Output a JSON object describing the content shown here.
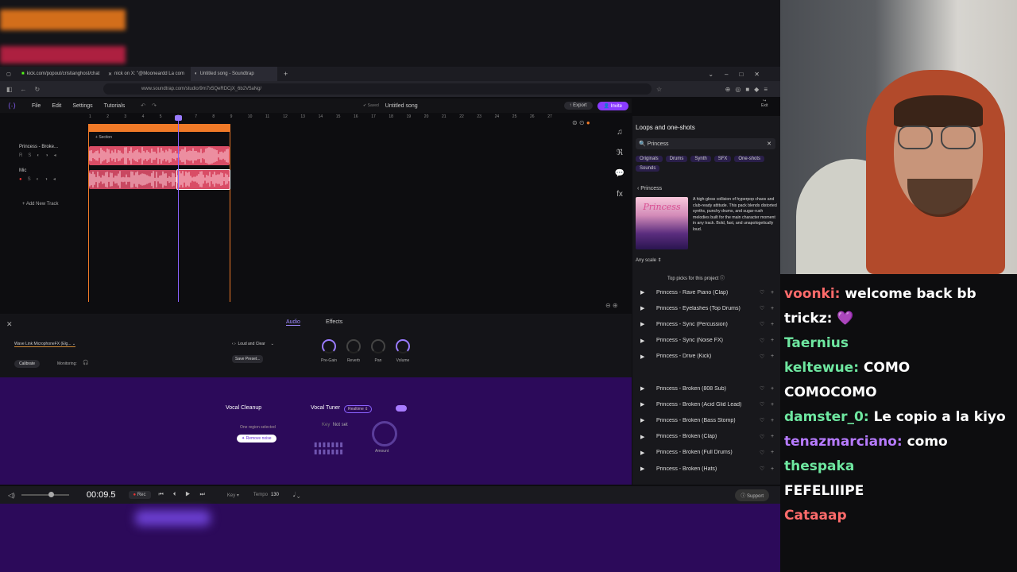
{
  "browser": {
    "tabs": [
      {
        "label": "kick.com/popout/cristianghost/chat"
      },
      {
        "label": "nick on X: \"@Mooneardd La com"
      },
      {
        "label": "Untitled song - Soundtrap"
      }
    ],
    "url": "www.soundtrap.com/studio/9m7x5QeRDCjX_6b2V5aNg/"
  },
  "app": {
    "menu": [
      "File",
      "Edit",
      "Settings",
      "Tutorials"
    ],
    "saved_label": "Saved",
    "song_title": "Untitled song",
    "export_label": "Export",
    "invite_label": "Invite",
    "exit_label": "Exit"
  },
  "timeline": {
    "ruler": [
      "1",
      "2",
      "3",
      "4",
      "5",
      "6",
      "7",
      "8",
      "9",
      "10",
      "11",
      "12",
      "13",
      "14",
      "15",
      "16",
      "17",
      "18",
      "19",
      "20",
      "21",
      "22",
      "23",
      "24",
      "25",
      "26",
      "27"
    ],
    "section_label": "Section",
    "playhead_fraction": 0.335
  },
  "tracks": [
    {
      "name": "Princess - Broke...",
      "color": "#e8566f"
    },
    {
      "name": "Mic",
      "color": "#e8566f"
    }
  ],
  "add_track_label": "Add New Track",
  "right_panel": {
    "title": "Loops and one-shots",
    "search_value": "Princess",
    "filters": [
      "Originals",
      "Drums",
      "Synth",
      "SFX",
      "One-shots",
      "Sounds"
    ],
    "back_label": "Princess",
    "pack_art_title": "Princess",
    "pack_description": "A high-gloss collision of hyperpop chaos and club-ready attitude. This pack blends distorted synths, punchy drums, and sugar-rush melodies built for the main character moment in any track. Bold, fast, and unapologetically loud.",
    "scale_label": "Any scale",
    "top_picks_label": "Top picks for this project",
    "top_picks": [
      "Princess - Rave Piano (Clap)",
      "Princess - Eyelashes (Top Drums)",
      "Princess - Sync (Percussion)",
      "Princess - Sync (Noise FX)",
      "Princess - Drive (Kick)"
    ],
    "more_loops": [
      "Princess - Broken (808 Sub)",
      "Princess - Broken (Acid Glid Lead)",
      "Princess - Broken (Bass Stomp)",
      "Princess - Broken (Clap)",
      "Princess - Broken (Full Drums)",
      "Princess - Broken (Hats)"
    ]
  },
  "bottom": {
    "tabs": [
      "Audio",
      "Effects"
    ],
    "device": "Wave Link MicrophoneFX (Elg...",
    "calibrate_label": "Calibrate",
    "monitoring_label": "Monitoring:",
    "preset": "Loud and Clear",
    "save_preset_label": "Save Preset...",
    "knobs": [
      "Pre-Gain",
      "Reverb",
      "Pan",
      "Volume"
    ],
    "vocal_cleanup_label": "Vocal Cleanup",
    "region_hint": "One region selected",
    "remove_noise_label": "Remove noise",
    "vocal_tuner_label": "Vocal Tuner",
    "realtime_label": "Realtime",
    "key_label": "Key",
    "key_value": "Not set",
    "amount_label": "Amount"
  },
  "transport": {
    "time": "00:09.5",
    "rec_label": "Rec",
    "key_label": "Key",
    "tempo_label": "Tempo",
    "tempo_value": "130",
    "support_label": "Support"
  },
  "chat": [
    {
      "user": "voonki",
      "text": "welcome back bb",
      "color": "#ff6b6b"
    },
    {
      "user": "trickz",
      "text": "💜",
      "color": "#ffffff"
    },
    {
      "user": "Taernius",
      "text": "",
      "color": "#6ee7a0"
    },
    {
      "user": "keltewue",
      "text": "COMO",
      "color": "#6ee7a0"
    },
    {
      "user": "",
      "text": "COMOCOMO",
      "color": "#ffffff"
    },
    {
      "user": "damster_0",
      "text": "Le copio a la kiyo",
      "color": "#6ee7a0"
    },
    {
      "user": "tenazmarciano",
      "text": "como",
      "color": "#b77bff"
    },
    {
      "user": "thespaka",
      "text": "",
      "color": "#6ee7a0"
    },
    {
      "user": "FEFELIIIPE",
      "text": "",
      "color": "#ffffff"
    },
    {
      "user": "Cataaap",
      "text": "",
      "color": "#ff6b6b"
    }
  ]
}
